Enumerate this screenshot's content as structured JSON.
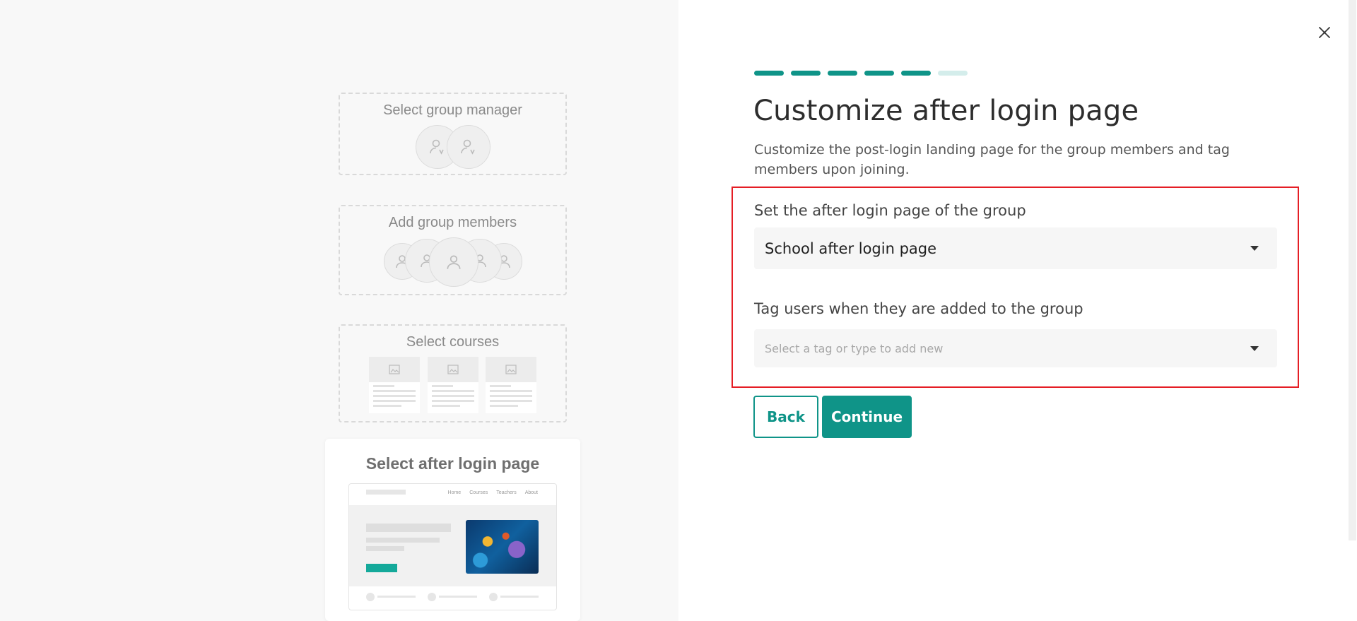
{
  "illustration": {
    "steps": [
      {
        "title": "Select group manager"
      },
      {
        "title": "Add group members"
      },
      {
        "title": "Select courses"
      },
      {
        "title": "Select after login page"
      }
    ],
    "mock_nav": [
      "Home",
      "Courses",
      "Teachers",
      "About"
    ]
  },
  "wizard": {
    "progress": {
      "completed_steps": 5,
      "total_steps": 6
    },
    "title": "Customize after login page",
    "subtitle": "Customize the post-login landing page for the group members and tag members upon joining.",
    "after_login": {
      "label": "Set the after login page of the group",
      "value": "School after login page"
    },
    "tags": {
      "label": "Tag users when they are added to the group",
      "placeholder": "Select a tag or type to add new"
    },
    "buttons": {
      "back": "Back",
      "continue": "Continue"
    }
  },
  "colors": {
    "accent": "#0f9488",
    "progress_pending": "#d4edeb",
    "highlight": "#e51e25"
  },
  "icons": {
    "close": "close-icon",
    "dropdown": "chevron-down-icon"
  }
}
